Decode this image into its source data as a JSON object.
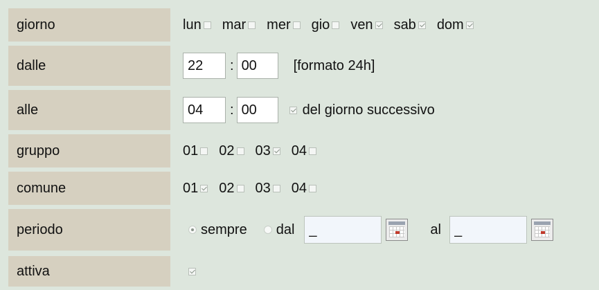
{
  "rows": {
    "giorno": {
      "label": "giorno",
      "options": [
        {
          "label": "lun",
          "checked": false
        },
        {
          "label": "mar",
          "checked": false
        },
        {
          "label": "mer",
          "checked": false
        },
        {
          "label": "gio",
          "checked": false
        },
        {
          "label": "ven",
          "checked": true
        },
        {
          "label": "sab",
          "checked": true
        },
        {
          "label": "dom",
          "checked": true
        }
      ]
    },
    "dalle": {
      "label": "dalle",
      "hour": "22",
      "minute": "00",
      "separator": ":",
      "note": "[formato 24h]"
    },
    "alle": {
      "label": "alle",
      "hour": "04",
      "minute": "00",
      "separator": ":",
      "next_day_checked": true,
      "next_day_label": "del giorno successivo"
    },
    "gruppo": {
      "label": "gruppo",
      "options": [
        {
          "label": "01",
          "checked": false
        },
        {
          "label": "02",
          "checked": false
        },
        {
          "label": "03",
          "checked": true
        },
        {
          "label": "04",
          "checked": false
        }
      ]
    },
    "comune": {
      "label": "comune",
      "options": [
        {
          "label": "01",
          "checked": true
        },
        {
          "label": "02",
          "checked": false
        },
        {
          "label": "03",
          "checked": false
        },
        {
          "label": "04",
          "checked": false
        }
      ]
    },
    "periodo": {
      "label": "periodo",
      "radio_sempre": "sempre",
      "radio_dal": "dal",
      "selected": "sempre",
      "dal_value": "_",
      "al_label": "al",
      "al_value": "_"
    },
    "attiva": {
      "label": "attiva",
      "checked": true
    }
  },
  "colors": {
    "page_background": "#dde6dd",
    "label_background": "#d6d0c0",
    "date_field_background": "#f2f6fb"
  },
  "icons": {
    "calendar": "calendar-icon"
  }
}
